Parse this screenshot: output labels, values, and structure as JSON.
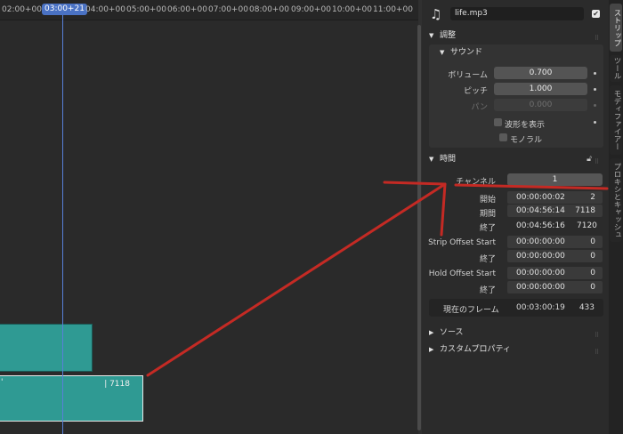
{
  "timeline": {
    "ruler_ticks": [
      "02:00+00",
      "04:00+00",
      "05:00+00",
      "06:00+00",
      "07:00+00",
      "08:00+00",
      "09:00+00",
      "10:00+00",
      "11:00+00"
    ],
    "current_frame": "03:00+21",
    "active_strip_label": "| 7118",
    "active_strip_mark": "'"
  },
  "header": {
    "file_name": "life.mp3",
    "checkbox_mark": "✔"
  },
  "sections": {
    "adjust": "調整",
    "sound": "サウンド",
    "time": "時間",
    "source": "ソース",
    "custom_props": "カスタムプロパティ"
  },
  "sound": {
    "volume_label": "ボリューム",
    "volume": "0.700",
    "pitch_label": "ピッチ",
    "pitch": "1.000",
    "pan_label": "パン",
    "pan": "0.000",
    "waveform_label": "波形を表示",
    "mono_label": "モノラル"
  },
  "time": {
    "channel_label": "チャンネル",
    "channel": "1",
    "start_label": "開始",
    "start_tc": "00:00:00:02",
    "start_frames": "2",
    "duration_label": "期間",
    "duration_tc": "00:04:56:14",
    "duration_frames": "7118",
    "end_label": "終了",
    "end_tc": "00:04:56:16",
    "end_frames": "7120",
    "strip_offset_start_label": "Strip Offset Start",
    "sos_tc": "00:00:00:00",
    "sos_frames": "0",
    "strip_offset_end_label": "終了",
    "soe_tc": "00:00:00:00",
    "soe_frames": "0",
    "hold_offset_start_label": "Hold Offset Start",
    "hos_tc": "00:00:00:00",
    "hos_frames": "0",
    "hold_offset_end_label": "終了",
    "hoe_tc": "00:00:00:00",
    "hoe_frames": "0",
    "current_frame_label": "現在のフレーム",
    "current_tc": "00:03:00:19",
    "current_frames": "433"
  },
  "tabs": [
    "ストリップ",
    "ツール",
    "モディファイアー",
    "プロキシとキャッシュ"
  ],
  "colors": {
    "strip": "#2f9a93",
    "accent": "#4a72c4",
    "annotation": "#c42a24"
  }
}
